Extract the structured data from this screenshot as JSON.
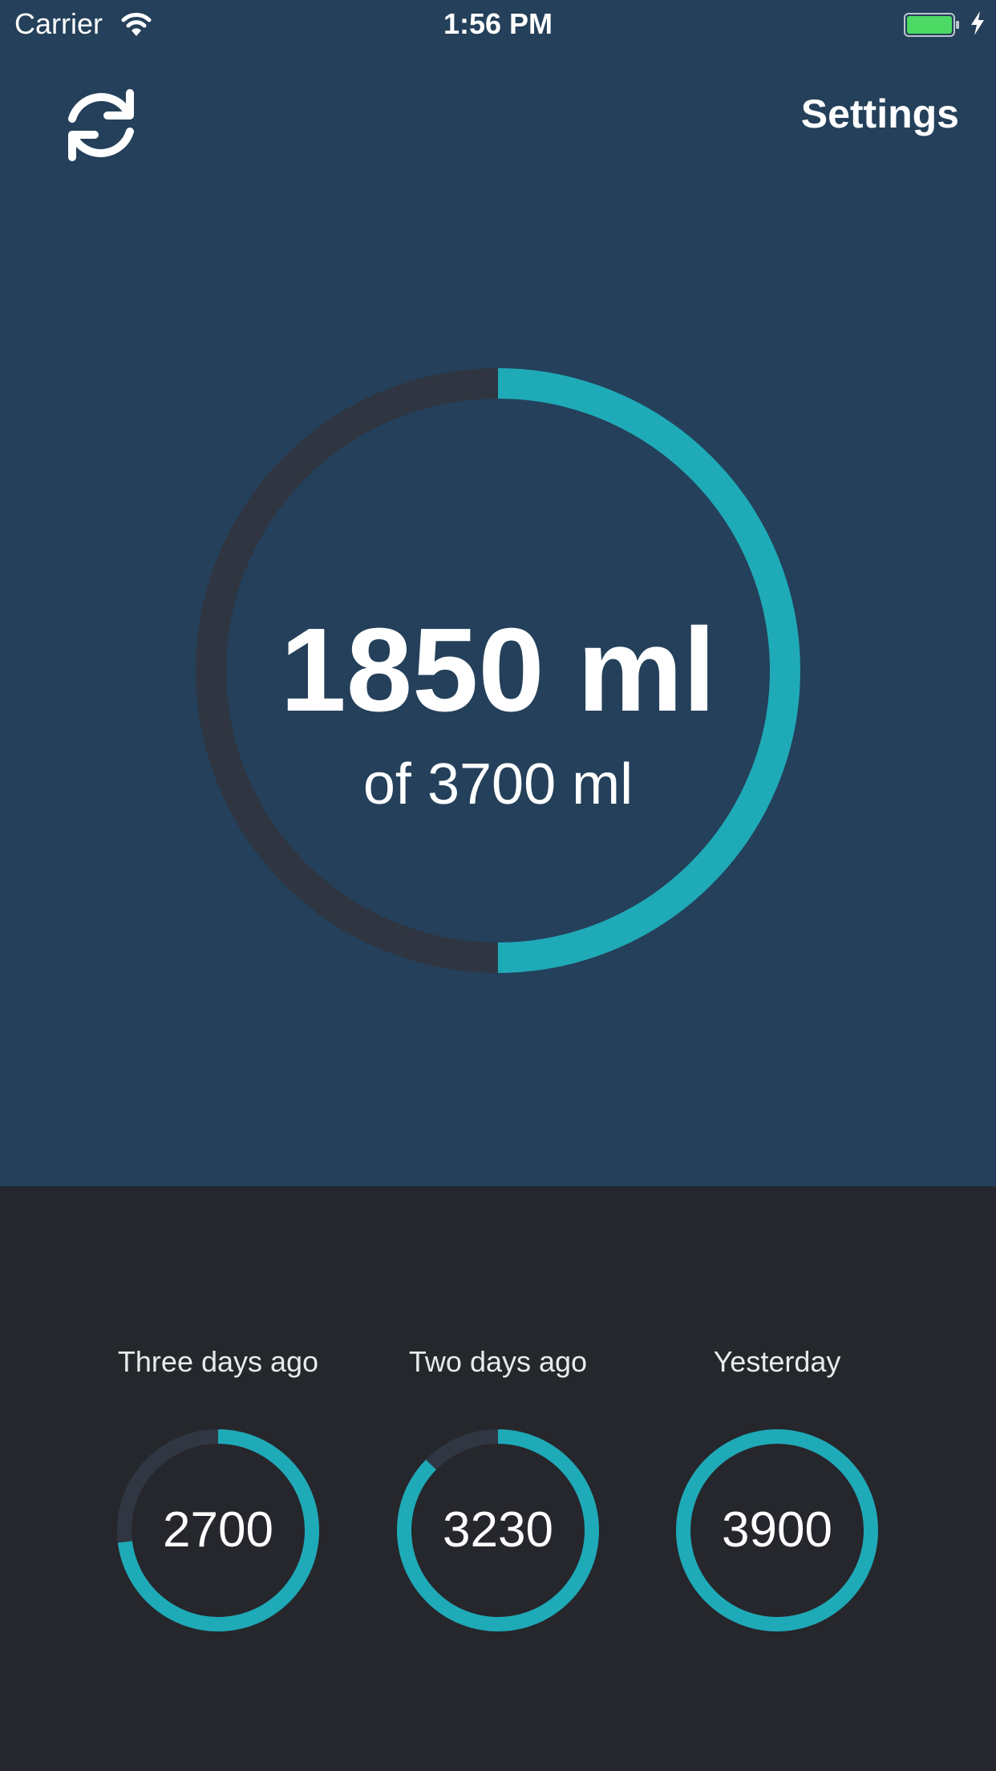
{
  "status_bar": {
    "carrier": "Carrier",
    "time": "1:56 PM"
  },
  "nav": {
    "refresh_icon": "refresh-icon",
    "settings_label": "Settings"
  },
  "today": {
    "value_label": "1850 ml",
    "goal_label": "of 3700 ml",
    "progress": 0.5
  },
  "history": [
    {
      "label": "Three days ago",
      "value": "2700",
      "progress": 0.73
    },
    {
      "label": "Two days ago",
      "value": "3230",
      "progress": 0.873
    },
    {
      "label": "Yesterday",
      "value": "3900",
      "progress": 1.0
    }
  ],
  "colors": {
    "top_background": "#24405a",
    "bottom_background": "#25272c",
    "ring_fill": "#1faab8",
    "main_ring_track": "#2f3641",
    "history_ring_track": "#303742",
    "battery_fill": "#4cd964"
  }
}
